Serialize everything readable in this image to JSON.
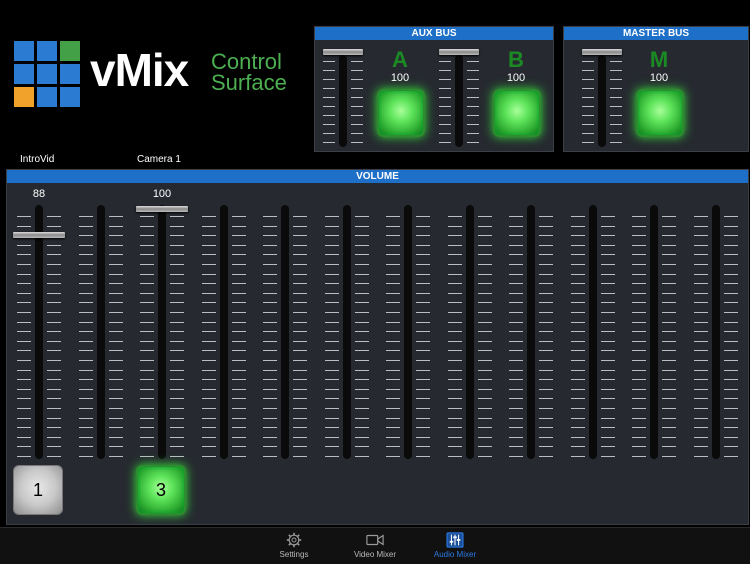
{
  "logo": {
    "name": "vMix",
    "line1": "Control",
    "line2": "Surface",
    "colors": {
      "blue": "#2b7bd3",
      "green": "#43a047",
      "orange": "#f0a22a",
      "text_green": "#4caf50"
    }
  },
  "aux_bus": {
    "title": "AUX BUS",
    "channels": [
      {
        "letter": "A",
        "value": "100"
      },
      {
        "letter": "B",
        "value": "100"
      }
    ]
  },
  "master_bus": {
    "title": "MASTER BUS",
    "channel": {
      "letter": "M",
      "value": "100"
    }
  },
  "volume": {
    "title": "VOLUME",
    "channels": [
      {
        "name": "IntroVid",
        "value": "88",
        "button": "1",
        "button_state": "off"
      },
      {
        "name": "",
        "value": "",
        "button": "",
        "button_state": "none"
      },
      {
        "name": "Camera 1",
        "value": "100",
        "button": "3",
        "button_state": "on"
      },
      {
        "name": ""
      },
      {
        "name": ""
      },
      {
        "name": ""
      },
      {
        "name": ""
      },
      {
        "name": ""
      },
      {
        "name": ""
      },
      {
        "name": ""
      },
      {
        "name": ""
      },
      {
        "name": ""
      }
    ]
  },
  "tabs": [
    {
      "label": "Settings",
      "icon": "gear-icon",
      "active": false
    },
    {
      "label": "Video Mixer",
      "icon": "video-camera-icon",
      "active": false
    },
    {
      "label": "Audio Mixer",
      "icon": "mixer-sliders-icon",
      "active": true
    }
  ],
  "accent": "#1e6fc7",
  "active_tab_color": "#2c7be5"
}
